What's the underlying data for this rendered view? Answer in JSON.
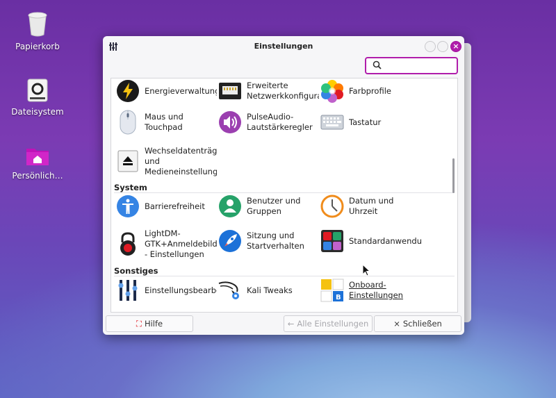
{
  "desktop": {
    "icons": [
      {
        "label": "Papierkorb",
        "icon": "trash-icon"
      },
      {
        "label": "Dateisystem",
        "icon": "drive-icon"
      },
      {
        "label": "Persönlich…",
        "icon": "home-folder-icon"
      }
    ]
  },
  "window": {
    "title": "Einstellungen",
    "search": {
      "placeholder": "",
      "value": ""
    },
    "sections": [
      {
        "name": "",
        "items": [
          {
            "label": "Energieverwaltung",
            "icon": "power-icon"
          },
          {
            "label": "Erweiterte\nNetzwerkkonfigurat",
            "icon": "network-icon"
          },
          {
            "label": "Farbprofile",
            "icon": "color-profile-icon"
          },
          {
            "label": "Maus und\nTouchpad",
            "icon": "mouse-icon"
          },
          {
            "label": "PulseAudio-\nLautstärkeregler",
            "icon": "speaker-icon"
          },
          {
            "label": "Tastatur",
            "icon": "keyboard-icon"
          },
          {
            "label": "Wechseldatenträger\nund\nMedieneinstellunge",
            "icon": "eject-icon"
          }
        ]
      },
      {
        "name": "System",
        "items": [
          {
            "label": "Barrierefreiheit",
            "icon": "accessibility-icon"
          },
          {
            "label": "Benutzer und\nGruppen",
            "icon": "users-icon"
          },
          {
            "label": "Datum und Uhrzeit",
            "icon": "clock-icon"
          },
          {
            "label": "LightDM-\nGTK+Anmeldebildsc\n- Einstellungen",
            "icon": "lock-icon"
          },
          {
            "label": "Sitzung und\nStartverhalten",
            "icon": "rocket-icon"
          },
          {
            "label": "Standardanwendung",
            "icon": "default-apps-icon"
          }
        ]
      },
      {
        "name": "Sonstiges",
        "items": [
          {
            "label": "Einstellungsbearbei",
            "icon": "settings-editor-icon"
          },
          {
            "label": "Kali Tweaks",
            "icon": "kali-dragon-icon"
          },
          {
            "label": "Onboard-\nEinstellungen",
            "icon": "onboard-keyboard-icon"
          }
        ]
      }
    ],
    "buttons": {
      "help": "Hilfe",
      "all_settings": "Alle Einstellungen",
      "close": "Schließen"
    }
  },
  "colors": {
    "accent": "#b01dab"
  }
}
